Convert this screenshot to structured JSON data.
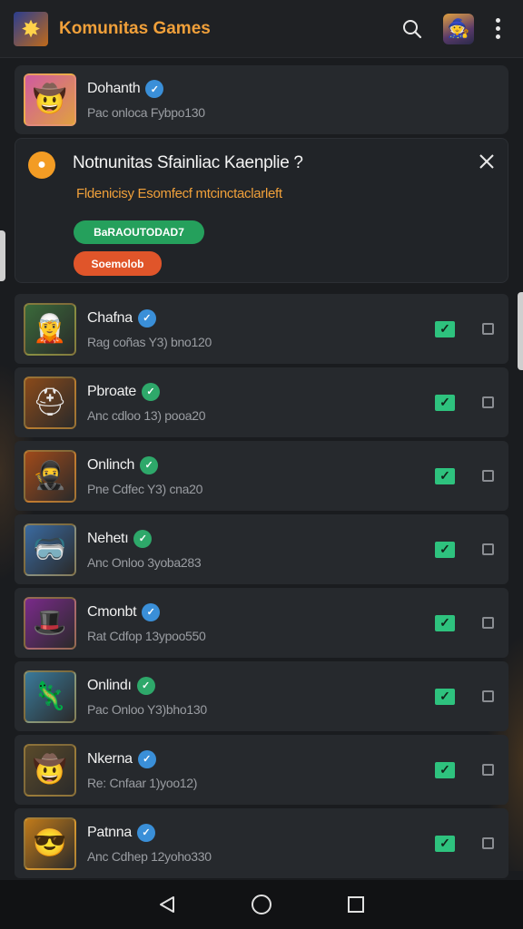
{
  "header": {
    "title": "Komunitas Games",
    "logo_glyph": "✸",
    "avatar_glyph": "🧙"
  },
  "featured": {
    "name": "Dohanth",
    "subtitle": "Pac onloca Fybpo130",
    "badge_color": "#3a8fd8",
    "badge_glyph": "✓",
    "thumb_glyph": "🤠"
  },
  "promo": {
    "title": "Notnunitas Sfainliac Kaenplie ?",
    "description": "Fldenicisy Esomfecf mtcinctaclarleft",
    "primary_button": "BaRAOUTODAD7",
    "secondary_button": "Soemolob",
    "icon_glyph": "●"
  },
  "games": [
    {
      "name": "Chafna",
      "subtitle": "Rag coñas Y3) bno120",
      "badge_color": "#3a8fd8",
      "thumb_glyph": "🧝",
      "thumb_bg": "#3a6a3a",
      "checked": true
    },
    {
      "name": "Pbroate",
      "subtitle": "Anc cdloo 13) pooa20",
      "badge_color": "#2ea86a",
      "thumb_glyph": "⛑",
      "thumb_bg": "#8a4a1a",
      "checked": true
    },
    {
      "name": "Onlinch",
      "subtitle": "Pne Cdfec Y3) cna20",
      "badge_color": "#2ea86a",
      "thumb_glyph": "🥷",
      "thumb_bg": "#a04a1a",
      "checked": true
    },
    {
      "name": "Nehetı",
      "subtitle": "Anc Onloo 3yoba283",
      "badge_color": "#2ea86a",
      "thumb_glyph": "🥽",
      "thumb_bg": "#3a6aa0",
      "checked": true
    },
    {
      "name": "Cmonbt",
      "subtitle": "Rat Cdfop 13ypoo550",
      "badge_color": "#3a8fd8",
      "thumb_glyph": "🎩",
      "thumb_bg": "#7a2a8a",
      "checked": true
    },
    {
      "name": "Onlindı",
      "subtitle": "Pac Onloo Y3)bho130",
      "badge_color": "#2ea86a",
      "thumb_glyph": "🦎",
      "thumb_bg": "#3a7a9a",
      "checked": true
    },
    {
      "name": "Nkerna",
      "subtitle": "Re: Cnfaar 1)yoo12)",
      "badge_color": "#3a8fd8",
      "thumb_glyph": "🤠",
      "thumb_bg": "#5a4a2a",
      "checked": true
    },
    {
      "name": "Patnna",
      "subtitle": "Anc Cdhep 12yoho330",
      "badge_color": "#3a8fd8",
      "thumb_glyph": "😎",
      "thumb_bg": "#c07a1a",
      "checked": true
    }
  ],
  "colors": {
    "accent": "#f0a03a",
    "check": "#2ec27e",
    "background": "#1a1c1f"
  },
  "icons": {
    "search": "search-icon",
    "more": "more-vert-icon",
    "close": "close-icon",
    "back": "nav-back-icon",
    "home": "nav-home-icon",
    "recents": "nav-recents-icon"
  }
}
